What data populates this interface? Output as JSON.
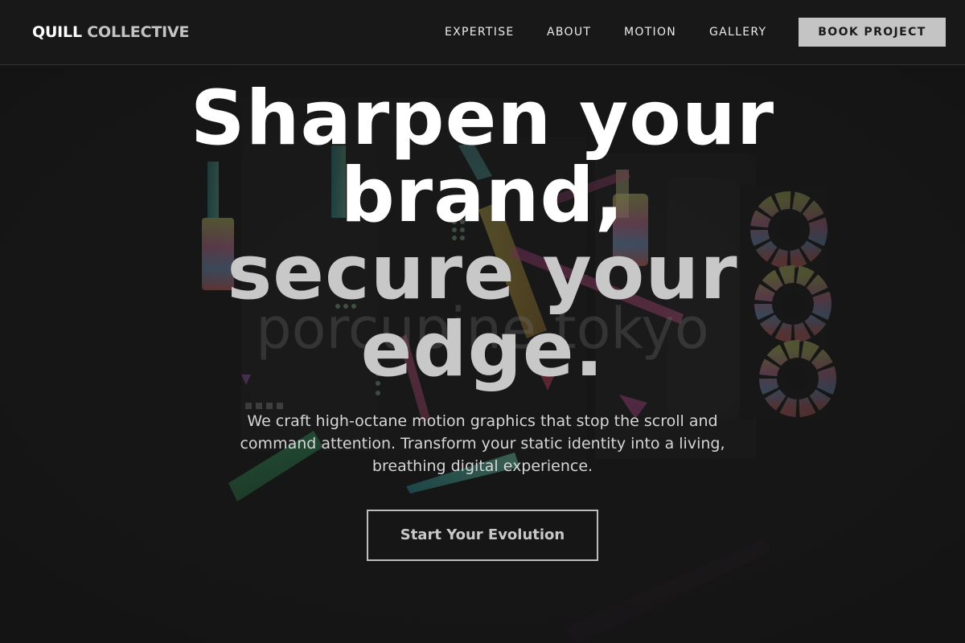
{
  "header": {
    "brand_primary": "QUILL",
    "brand_secondary": "COLLECTIVE",
    "nav": [
      {
        "label": "EXPERTISE"
      },
      {
        "label": "ABOUT"
      },
      {
        "label": "MOTION"
      },
      {
        "label": "GALLERY"
      }
    ],
    "cta_label": "BOOK PROJECT"
  },
  "hero": {
    "headline_line1": "Sharpen your",
    "headline_line2": "brand,",
    "headline_line3": "secure your",
    "headline_line4": "edge.",
    "background_text": "porcupine tokyo",
    "subtext": "We craft high-octane motion graphics that stop the scroll and command attention. Transform your static identity into a living, breathing digital experience.",
    "cta_label": "Start Your Evolution"
  },
  "colors": {
    "background": "#151515",
    "header_background": "#181818",
    "accent_button": "#c4c4c4",
    "headline_white": "#ffffff",
    "headline_grey": "#c8c8c8",
    "body_text": "#d6d6d6"
  }
}
